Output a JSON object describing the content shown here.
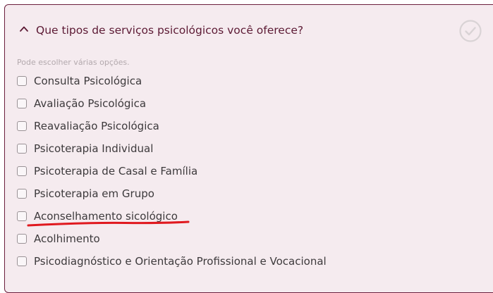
{
  "question": {
    "title": "Que tipos de serviços psicológicos você oferece?",
    "hint": "Pode escolher várias opções."
  },
  "icons": {
    "collapse": "chevron-up-icon",
    "complete": "check-circle-icon"
  },
  "colors": {
    "accent": "#5c1a34",
    "panel_bg": "#f5ebef",
    "border": "#6b1f3d",
    "annotation": "#e0191f",
    "check_circle": "#d9d3d5"
  },
  "options": [
    {
      "label": "Consulta Psicológica",
      "checked": false
    },
    {
      "label": "Avaliação Psicológica",
      "checked": false
    },
    {
      "label": "Reavaliação Psicológica",
      "checked": false
    },
    {
      "label": "Psicoterapia Individual",
      "checked": false
    },
    {
      "label": "Psicoterapia de Casal e Família",
      "checked": false
    },
    {
      "label": "Psicoterapia em Grupo",
      "checked": false
    },
    {
      "label": "Aconselhamento sicológico",
      "checked": false
    },
    {
      "label": "Acolhimento",
      "checked": false
    },
    {
      "label": "Psicodiagnóstico e Orientação Profissional e Vocacional",
      "checked": false
    }
  ]
}
